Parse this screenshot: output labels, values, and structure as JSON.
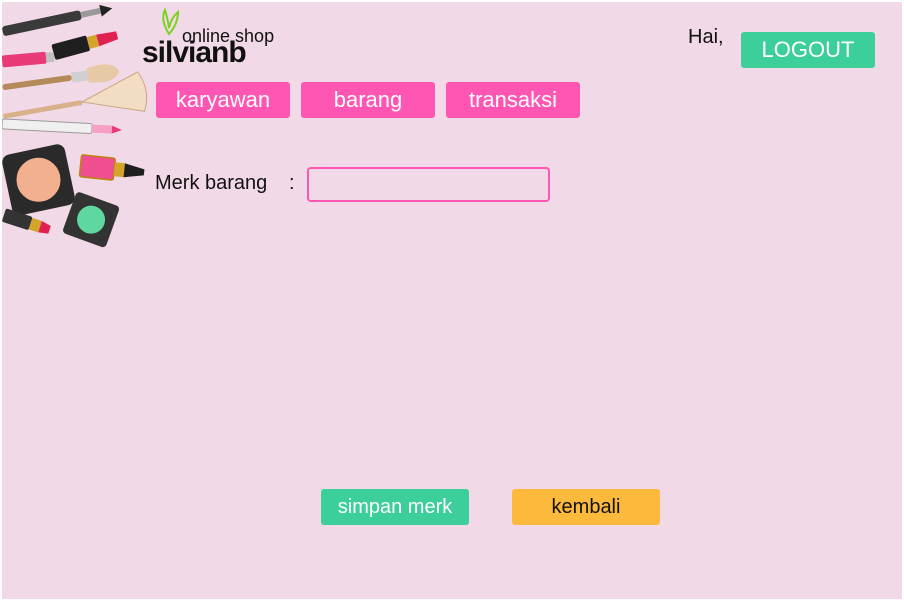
{
  "logo": {
    "online": "online shop",
    "name": "silvianb"
  },
  "header": {
    "greeting": "Hai,",
    "logout_label": "LOGOUT"
  },
  "nav": {
    "items": [
      "karyawan",
      "barang",
      "transaksi"
    ]
  },
  "form": {
    "merk_label": "Merk barang",
    "colon": ":",
    "merk_value": "",
    "merk_placeholder": ""
  },
  "actions": {
    "save_label": "simpan merk",
    "back_label": "kembali"
  },
  "colors": {
    "background": "#f2d9e8",
    "pink": "#ff56b4",
    "green": "#3ccf99",
    "orange": "#fdb93c"
  }
}
